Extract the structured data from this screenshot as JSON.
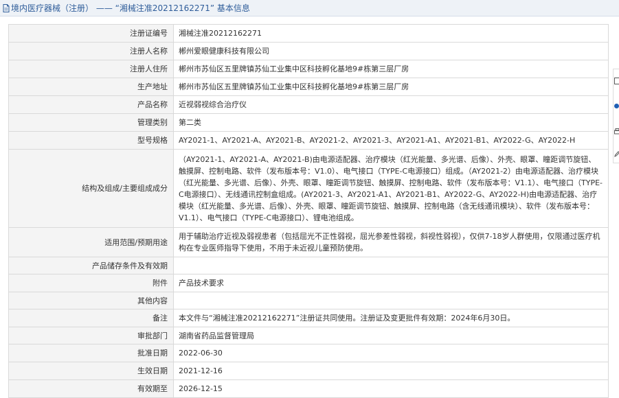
{
  "header": {
    "title": "境内医疗器械（注册） —— “湘械注准20212162271” 基本信息",
    "icon": "document-icon"
  },
  "rows": [
    {
      "label": "注册证编号",
      "value": "湘械注准20212162271"
    },
    {
      "label": "注册人名称",
      "value": "郴州爱眼健康科技有限公司"
    },
    {
      "label": "注册人住所",
      "value": "郴州市苏仙区五里牌镇苏仙工业集中区科技孵化基地9#栋第三层厂房"
    },
    {
      "label": "生产地址",
      "value": "郴州市苏仙区五里牌镇苏仙工业集中区科技孵化基地9#栋第三层厂房"
    },
    {
      "label": "产品名称",
      "value": "近视弱视综合治疗仪"
    },
    {
      "label": "管理类别",
      "value": "第二类"
    },
    {
      "label": "型号规格",
      "value": "AY2021-1、AY2021-A、AY2021-B、AY2021-2、AY2021-3、AY2021-A1、AY2021-B1、AY2022-G、AY2022-H"
    },
    {
      "label": "结构及组成/主要组成成分",
      "value": "（AY2021-1、AY2021-A、AY2021-B)由电源适配器、治疗模块（红光能量、多光谱、后像）、外壳、眼罩、瞳距调节旋钮、触摸屏、控制电路、软件（发布版本号：V1.0）、电气接口（TYPE-C电源接口）组成。（AY2021-2）由电源适配器、治疗模块（红光能量、多光谱、后像）、外壳、眼罩、瞳距调节旋钮、触摸屏、控制电路、软件（发布版本号：V1.1）、电气接口（TYPE-C电源接口）、无线通讯控制盒组成。(AY2021-3、AY2021-A1、AY2021-B1、AY2022-G、AY2022-H)由电源适配器、治疗模块（红光能量、多光谱、后像）、外壳、眼罩、瞳距调节旋钮、触摸屏、控制电路（含无线通讯模块）、软件（发布版本号：V1.1）、电气接口（TYPE-C电源接口）、锂电池组成。"
    },
    {
      "label": "适用范围/预期用途",
      "value": "用于辅助治疗近视及弱视患者（包括屈光不正性弱视，屈光参差性弱视，斜视性弱视），仅供7-18岁人群使用，仅限通过医疗机构在专业医师指导下使用，不用于未近视儿童预防使用。"
    },
    {
      "label": "产品储存条件及有效期",
      "value": ""
    },
    {
      "label": "附件",
      "value": "产品技术要求"
    },
    {
      "label": "其他内容",
      "value": ""
    },
    {
      "label": "备注",
      "value": "本文件与“湘械注准20212162271”注册证共同使用。注册证及变更批件有效期：2024年6月30日。"
    },
    {
      "label": "审批部门",
      "value": "湖南省药品监督管理局"
    },
    {
      "label": "批准日期",
      "value": "2022-06-30"
    },
    {
      "label": "生效日期",
      "value": "2021-12-16"
    },
    {
      "label": "有效期至",
      "value": "2026-12-15"
    }
  ],
  "colors": {
    "title_blue": "#2f5d9a",
    "label_bg": "#f4f4f4",
    "border": "#d9d9d9",
    "header_bg": "#eef2f7"
  }
}
